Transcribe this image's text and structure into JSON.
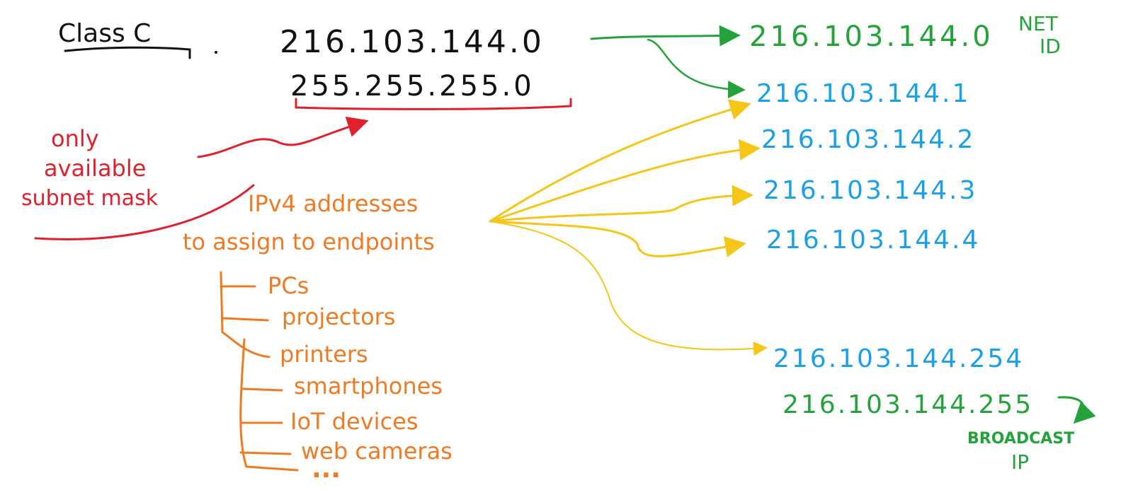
{
  "title": "Class C",
  "network": {
    "address": "216.103.144.0",
    "mask": "255.255.255.0"
  },
  "notes": {
    "mask_note_lines": [
      "only",
      "available",
      "subnet mask"
    ],
    "hosts_note_lines": [
      "IPv4 addresses",
      "to assign to endpoints"
    ]
  },
  "endpoints": [
    "PCs",
    "projectors",
    "printers",
    "smartphones",
    "IoT devices",
    "web cameras",
    "..."
  ],
  "addresses": {
    "net_id": {
      "address": "216.103.144.0",
      "label_lines": [
        "NET",
        "ID"
      ]
    },
    "hosts": [
      "216.103.144.1",
      "216.103.144.2",
      "216.103.144.3",
      "216.103.144.4",
      "216.103.144.254"
    ],
    "broadcast": {
      "address": "216.103.144.255",
      "label_lines": [
        "BROADCAST",
        "IP"
      ]
    }
  },
  "colors": {
    "title": "#111111",
    "mask_note": "#e0202a",
    "endpoints": "#f07a22",
    "net_and_broadcast": "#23a33a",
    "hosts": "#1aa0e6",
    "host_arrows": "#f5c518"
  }
}
